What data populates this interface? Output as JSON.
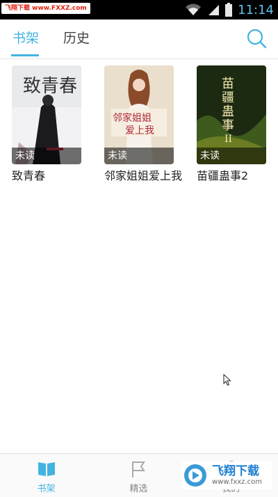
{
  "status_bar": {
    "watermark": "飞翔下载 www.FXXZ.com",
    "time": "11:14"
  },
  "top_tabs": [
    {
      "label": "书架",
      "active": true
    },
    {
      "label": "历史",
      "active": false
    }
  ],
  "books": [
    {
      "title": "致青春",
      "status": "未读",
      "cover_text": "致青春"
    },
    {
      "title": "邻家姐姐爱上我",
      "status": "未读",
      "cover_text": "邻家姐姐爱上我"
    },
    {
      "title": "苗疆蛊事2",
      "status": "未读",
      "cover_text": "苗疆蛊事II"
    }
  ],
  "bottom_nav": [
    {
      "label": "书架",
      "icon": "book-open-icon",
      "active": true
    },
    {
      "label": "精选",
      "icon": "flag-icon",
      "active": false
    },
    {
      "label": "我的",
      "icon": "user-icon",
      "active": false
    }
  ],
  "watermark_logo": {
    "brand": "飞翔下载",
    "url": "www.fxxz.com"
  },
  "colors": {
    "accent": "#45b3e0",
    "status_bar": "#000000"
  }
}
